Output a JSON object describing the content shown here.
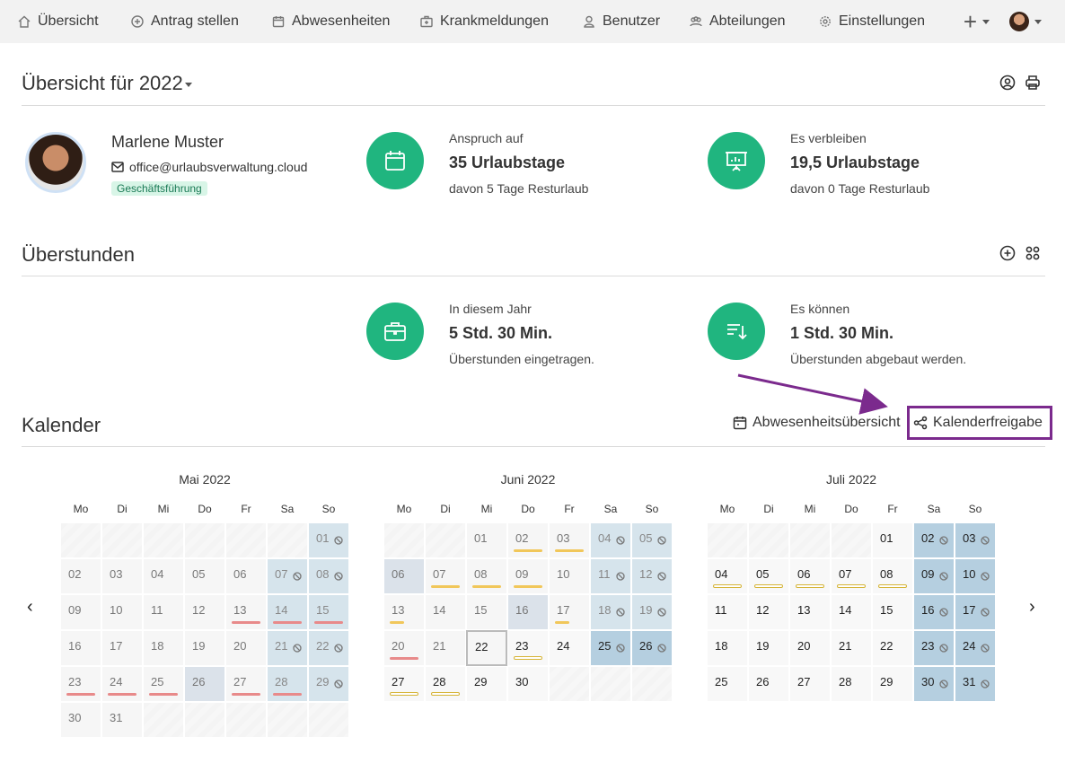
{
  "nav": {
    "items": [
      {
        "label": "Übersicht",
        "icon": "home-icon"
      },
      {
        "label": "Antrag stellen",
        "icon": "plus-circle-icon"
      },
      {
        "label": "Abwesenheiten",
        "icon": "calendar-icon"
      },
      {
        "label": "Krankmeldungen",
        "icon": "medical-case-icon"
      },
      {
        "label": "Benutzer",
        "icon": "user-icon"
      },
      {
        "label": "Abteilungen",
        "icon": "group-icon"
      },
      {
        "label": "Einstellungen",
        "icon": "gear-icon"
      }
    ],
    "add_label": "+"
  },
  "overview": {
    "title": "Übersicht für 2022"
  },
  "user": {
    "name": "Marlene Muster",
    "email": "office@urlaubsverwaltung.cloud",
    "role": "Geschäftsführung"
  },
  "vacation": {
    "entitlement_label": "Anspruch auf",
    "entitlement_value": "35 Urlaubstage",
    "entitlement_sub": "davon 5 Tage Resturlaub",
    "remaining_label": "Es verbleiben",
    "remaining_value": "19,5 Urlaubstage",
    "remaining_sub": "davon 0 Tage Resturlaub"
  },
  "overtime": {
    "title": "Überstunden",
    "year_label": "In diesem Jahr",
    "year_value": "5 Std. 30 Min.",
    "year_sub": "Überstunden eingetragen.",
    "reduce_label": "Es können",
    "reduce_value": "1 Std. 30 Min.",
    "reduce_sub": "Überstunden abgebaut werden."
  },
  "calendar": {
    "title": "Kalender",
    "absence_overview_label": "Abwesenheitsübersicht",
    "share_label": "Kalenderfreigabe",
    "prev_label": "‹",
    "next_label": "›",
    "weekdays": [
      "Mo",
      "Di",
      "Mi",
      "Do",
      "Fr",
      "Sa",
      "So"
    ],
    "months": [
      {
        "title": "Mai 2022",
        "offset": 6,
        "days": [
          {
            "d": "01",
            "t": "past-weekend",
            "b": true
          },
          {
            "d": "02",
            "t": "past"
          },
          {
            "d": "03",
            "t": "past"
          },
          {
            "d": "04",
            "t": "past"
          },
          {
            "d": "05",
            "t": "past"
          },
          {
            "d": "06",
            "t": "past"
          },
          {
            "d": "07",
            "t": "past-weekend",
            "b": true
          },
          {
            "d": "08",
            "t": "past-weekend",
            "b": true
          },
          {
            "d": "09",
            "t": "past"
          },
          {
            "d": "10",
            "t": "past"
          },
          {
            "d": "11",
            "t": "past"
          },
          {
            "d": "12",
            "t": "past"
          },
          {
            "d": "13",
            "t": "past",
            "m": "red"
          },
          {
            "d": "14",
            "t": "past-weekend",
            "m": "red"
          },
          {
            "d": "15",
            "t": "past-weekend",
            "m": "red"
          },
          {
            "d": "16",
            "t": "past"
          },
          {
            "d": "17",
            "t": "past"
          },
          {
            "d": "18",
            "t": "past"
          },
          {
            "d": "19",
            "t": "past"
          },
          {
            "d": "20",
            "t": "past"
          },
          {
            "d": "21",
            "t": "past-weekend",
            "b": true
          },
          {
            "d": "22",
            "t": "past-weekend",
            "b": true
          },
          {
            "d": "23",
            "t": "past",
            "m": "red"
          },
          {
            "d": "24",
            "t": "past",
            "m": "red"
          },
          {
            "d": "25",
            "t": "past",
            "m": "red"
          },
          {
            "d": "26",
            "t": "holiday"
          },
          {
            "d": "27",
            "t": "past",
            "m": "red"
          },
          {
            "d": "28",
            "t": "past-weekend",
            "m": "red"
          },
          {
            "d": "29",
            "t": "past-weekend",
            "b": true
          },
          {
            "d": "30",
            "t": "past"
          },
          {
            "d": "31",
            "t": "past"
          }
        ]
      },
      {
        "title": "Juni 2022",
        "offset": 2,
        "days": [
          {
            "d": "01",
            "t": "past"
          },
          {
            "d": "02",
            "t": "past",
            "m": "yellow"
          },
          {
            "d": "03",
            "t": "past",
            "m": "yellow"
          },
          {
            "d": "04",
            "t": "past-weekend",
            "b": true
          },
          {
            "d": "05",
            "t": "past-weekend",
            "b": true
          },
          {
            "d": "06",
            "t": "holiday"
          },
          {
            "d": "07",
            "t": "past",
            "m": "yellow"
          },
          {
            "d": "08",
            "t": "past",
            "m": "yellow"
          },
          {
            "d": "09",
            "t": "past",
            "m": "yellow"
          },
          {
            "d": "10",
            "t": "past"
          },
          {
            "d": "11",
            "t": "past-weekend",
            "b": true
          },
          {
            "d": "12",
            "t": "past-weekend",
            "b": true
          },
          {
            "d": "13",
            "t": "past",
            "m": "half"
          },
          {
            "d": "14",
            "t": "past"
          },
          {
            "d": "15",
            "t": "past"
          },
          {
            "d": "16",
            "t": "holiday"
          },
          {
            "d": "17",
            "t": "past",
            "m": "half"
          },
          {
            "d": "18",
            "t": "past-weekend",
            "b": true
          },
          {
            "d": "19",
            "t": "past-weekend",
            "b": true
          },
          {
            "d": "20",
            "t": "past",
            "m": "red"
          },
          {
            "d": "21",
            "t": "past"
          },
          {
            "d": "22",
            "t": "today"
          },
          {
            "d": "23",
            "t": "work",
            "m": "outline"
          },
          {
            "d": "24",
            "t": "work"
          },
          {
            "d": "25",
            "t": "weekend",
            "b": true
          },
          {
            "d": "26",
            "t": "weekend",
            "b": true
          },
          {
            "d": "27",
            "t": "work",
            "m": "outline"
          },
          {
            "d": "28",
            "t": "work",
            "m": "outline"
          },
          {
            "d": "29",
            "t": "work"
          },
          {
            "d": "30",
            "t": "work"
          }
        ]
      },
      {
        "title": "Juli 2022",
        "offset": 4,
        "days": [
          {
            "d": "01",
            "t": "work"
          },
          {
            "d": "02",
            "t": "weekend",
            "b": true
          },
          {
            "d": "03",
            "t": "weekend",
            "b": true
          },
          {
            "d": "04",
            "t": "work",
            "m": "outline"
          },
          {
            "d": "05",
            "t": "work",
            "m": "outline"
          },
          {
            "d": "06",
            "t": "work",
            "m": "outline"
          },
          {
            "d": "07",
            "t": "work",
            "m": "outline"
          },
          {
            "d": "08",
            "t": "work",
            "m": "outline"
          },
          {
            "d": "09",
            "t": "weekend",
            "b": true
          },
          {
            "d": "10",
            "t": "weekend",
            "b": true
          },
          {
            "d": "11",
            "t": "work"
          },
          {
            "d": "12",
            "t": "work"
          },
          {
            "d": "13",
            "t": "work"
          },
          {
            "d": "14",
            "t": "work"
          },
          {
            "d": "15",
            "t": "work"
          },
          {
            "d": "16",
            "t": "weekend",
            "b": true
          },
          {
            "d": "17",
            "t": "weekend",
            "b": true
          },
          {
            "d": "18",
            "t": "work"
          },
          {
            "d": "19",
            "t": "work"
          },
          {
            "d": "20",
            "t": "work"
          },
          {
            "d": "21",
            "t": "work"
          },
          {
            "d": "22",
            "t": "work"
          },
          {
            "d": "23",
            "t": "weekend",
            "b": true
          },
          {
            "d": "24",
            "t": "weekend",
            "b": true
          },
          {
            "d": "25",
            "t": "work"
          },
          {
            "d": "26",
            "t": "work"
          },
          {
            "d": "27",
            "t": "work"
          },
          {
            "d": "28",
            "t": "work"
          },
          {
            "d": "29",
            "t": "work"
          },
          {
            "d": "30",
            "t": "weekend",
            "b": true
          },
          {
            "d": "31",
            "t": "weekend",
            "b": true
          }
        ]
      }
    ]
  },
  "colors": {
    "accent_green": "#20b57f",
    "highlight_purple": "#7b2a8d",
    "weekend_blue": "#b5cfe0"
  }
}
